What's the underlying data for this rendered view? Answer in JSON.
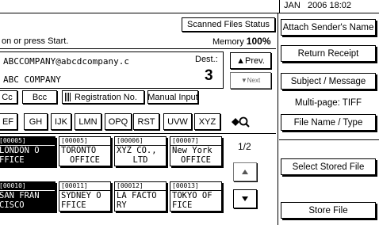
{
  "clock": "JAN   2006 18:02",
  "status_button": "Scanned Files Status",
  "prompt": "on or press Start.",
  "memory_label": "Memory",
  "memory_value": "100%",
  "destination": {
    "address": "ABCCOMPANY@abcdcompany.c",
    "name": "ABC COMPANY",
    "dest_label": "Dest.:",
    "dest_count": "3",
    "prev_label": "▲Prev.",
    "next_label": "▼Next"
  },
  "field_tabs": [
    "Cc",
    "Bcc",
    "Registration No.",
    "Manual Input"
  ],
  "index_tabs": [
    "EF",
    "GH",
    "IJK",
    "LMN",
    "OPQ",
    "RST",
    "UVW",
    "XYZ"
  ],
  "search_icon": "search-icon",
  "destinations_row1": [
    {
      "num": "[00005]",
      "line1": "LONDON O",
      "line2": "FFICE",
      "selected": true
    },
    {
      "num": "[00005]",
      "line1": "TORONTO",
      "line2": "OFFICE",
      "selected": false
    },
    {
      "num": "[00006]",
      "line1": "XYZ CO.,",
      "line2": "LTD",
      "selected": false
    },
    {
      "num": "[00007]",
      "line1": "New York",
      "line2": "OFFICE",
      "selected": false
    }
  ],
  "destinations_row2": [
    {
      "num": "[00010]",
      "line1": "SAN FRAN",
      "line2": "CISCO",
      "selected": true
    },
    {
      "num": "[00011]",
      "line1": "SYDNEY O",
      "line2": "FFICE",
      "selected": false
    },
    {
      "num": "[00012]",
      "line1": "LA FACTO",
      "line2": "RY",
      "selected": false
    },
    {
      "num": "[00013]",
      "line1": "TOKYO OF",
      "line2": "FICE",
      "selected": false
    }
  ],
  "page_indicator": "1/2",
  "page_up_icon": "triangle-up-icon",
  "page_down_icon": "triangle-down-icon",
  "right_panel": {
    "attach_sender": "Attach Sender's Name",
    "return_receipt": "Return Receipt",
    "subject": "Subject / Message",
    "multipage": "Multi-page: TIFF",
    "file_name": "File Name / Type",
    "select_stored": "Select Stored File",
    "store_file": "Store File"
  }
}
